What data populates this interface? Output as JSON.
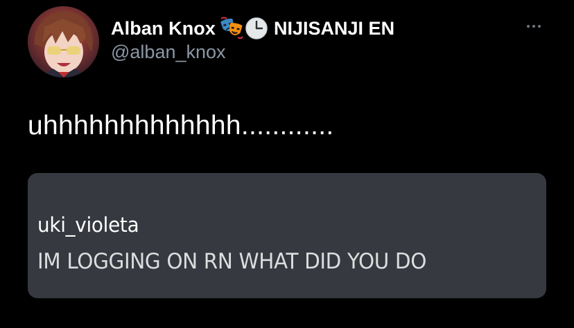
{
  "tweet": {
    "author": {
      "display_name": "Alban Knox",
      "name_emojis": [
        "performing-arts-emoji",
        "clock-emoji"
      ],
      "affiliation": "NIJISANJI EN",
      "handle": "@alban_knox",
      "avatar": "avatar-image"
    },
    "more_menu_icon": "more-dots-icon",
    "text": "uhhhhhhhhhhhhh............"
  },
  "embedded_message": {
    "username": "uki_violeta",
    "message": "IM LOGGING ON RN WHAT DID YOU DO"
  },
  "colors": {
    "background": "#000000",
    "text_primary": "#ffffff",
    "handle": "#8b98a5",
    "embed_background": "#36393f",
    "embed_message": "#dcddde",
    "more_dots": "#71767b"
  }
}
